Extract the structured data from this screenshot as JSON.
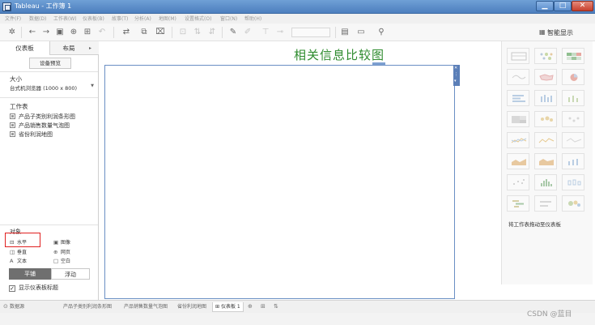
{
  "window": {
    "title": "Tableau - 工作簿 1",
    "min_label": "▁",
    "max_label": "□",
    "close_label": "✕"
  },
  "menu": [
    "文件(F)",
    "数据(D)",
    "工作表(W)",
    "仪表板(B)",
    "故事(T)",
    "分析(A)",
    "地图(M)",
    "设置格式(O)",
    "窗口(N)",
    "帮助(H)"
  ],
  "toolbar": {
    "smart_show_label": "智能显示"
  },
  "leftpane": {
    "tabs": {
      "dashboard": "仪表板",
      "layout": "布局"
    },
    "device_preview": "设备预览",
    "size": {
      "label": "大小",
      "value": "台式机浏览器 (1000 x 800)"
    },
    "sheets": {
      "label": "工作表",
      "items": [
        "产品子类别利润条形图",
        "产品销售数量气泡图",
        "省份利润地图"
      ]
    },
    "objects": {
      "label": "对象",
      "items": [
        {
          "label": "水平",
          "icon": "horizontal-icon"
        },
        {
          "label": "图像",
          "icon": "image-icon"
        },
        {
          "label": "垂直",
          "icon": "vertical-icon"
        },
        {
          "label": "网页",
          "icon": "webpage-icon"
        },
        {
          "label": "文本",
          "icon": "text-icon"
        },
        {
          "label": "空白",
          "icon": "blank-icon"
        }
      ]
    },
    "tiled": "平铺",
    "floating": "浮动",
    "show_title": "显示仪表板标题",
    "show_title_checked": true
  },
  "canvas": {
    "title": "相关信息比较图",
    "title_color": "#2e8b2e"
  },
  "rightpane": {
    "hint": "将工作表拖动至仪表板"
  },
  "bottom": {
    "datasource": "数据源",
    "sheets": [
      "产品子类别利润条形图",
      "产品销售数量气泡图",
      "省份利润地图"
    ],
    "active": "仪表板 1"
  },
  "watermark": "CSDN @蓝目"
}
